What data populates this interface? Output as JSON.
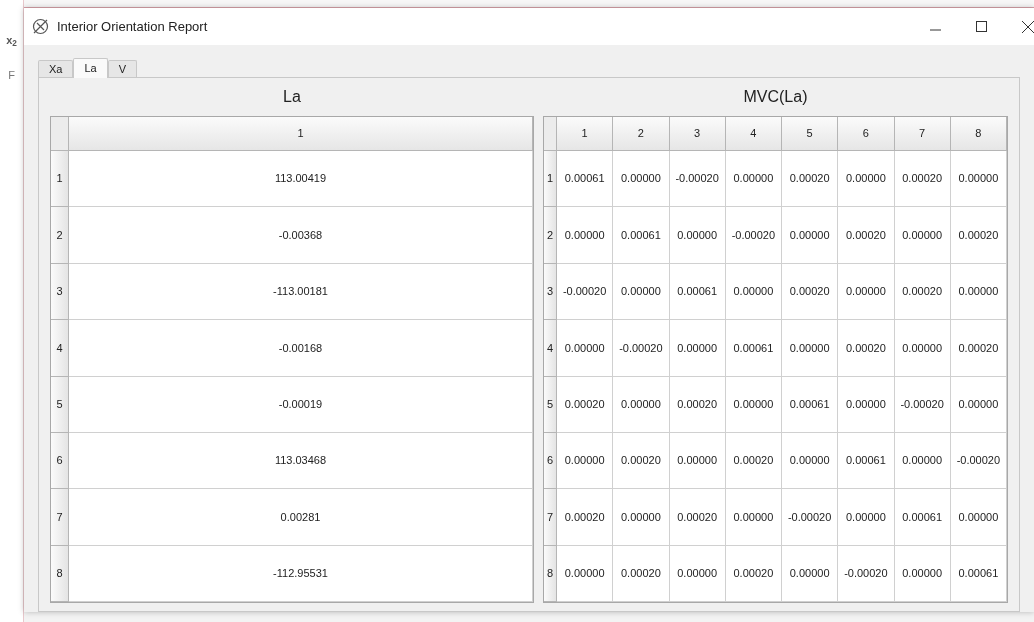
{
  "background": {
    "texts": [
      "x$_{2}$",
      "F"
    ]
  },
  "window": {
    "title": "Interior Orientation Report"
  },
  "tabs": [
    {
      "label": "Xa",
      "selected": false
    },
    {
      "label": "La",
      "selected": true
    },
    {
      "label": "V",
      "selected": false
    }
  ],
  "la_table": {
    "title": "La",
    "columns": [
      "1"
    ],
    "rows": [
      {
        "header": "1",
        "cells": [
          "113.00419"
        ]
      },
      {
        "header": "2",
        "cells": [
          "-0.00368"
        ]
      },
      {
        "header": "3",
        "cells": [
          "-113.00181"
        ]
      },
      {
        "header": "4",
        "cells": [
          "-0.00168"
        ]
      },
      {
        "header": "5",
        "cells": [
          "-0.00019"
        ]
      },
      {
        "header": "6",
        "cells": [
          "113.03468"
        ]
      },
      {
        "header": "7",
        "cells": [
          "0.00281"
        ]
      },
      {
        "header": "8",
        "cells": [
          "-112.95531"
        ]
      }
    ]
  },
  "mvc_table": {
    "title": "MVC(La)",
    "columns": [
      "1",
      "2",
      "3",
      "4",
      "5",
      "6",
      "7",
      "8"
    ],
    "rows": [
      {
        "header": "1",
        "cells": [
          "0.00061",
          "0.00000",
          "-0.00020",
          "0.00000",
          "0.00020",
          "0.00000",
          "0.00020",
          "0.00000"
        ]
      },
      {
        "header": "2",
        "cells": [
          "0.00000",
          "0.00061",
          "0.00000",
          "-0.00020",
          "0.00000",
          "0.00020",
          "0.00000",
          "0.00020"
        ]
      },
      {
        "header": "3",
        "cells": [
          "-0.00020",
          "0.00000",
          "0.00061",
          "0.00000",
          "0.00020",
          "0.00000",
          "0.00020",
          "0.00000"
        ]
      },
      {
        "header": "4",
        "cells": [
          "0.00000",
          "-0.00020",
          "0.00000",
          "0.00061",
          "0.00000",
          "0.00020",
          "0.00000",
          "0.00020"
        ]
      },
      {
        "header": "5",
        "cells": [
          "0.00020",
          "0.00000",
          "0.00020",
          "0.00000",
          "0.00061",
          "0.00000",
          "-0.00020",
          "0.00000"
        ]
      },
      {
        "header": "6",
        "cells": [
          "0.00000",
          "0.00020",
          "0.00000",
          "0.00020",
          "0.00000",
          "0.00061",
          "0.00000",
          "-0.00020"
        ]
      },
      {
        "header": "7",
        "cells": [
          "0.00020",
          "0.00000",
          "0.00020",
          "0.00000",
          "-0.00020",
          "0.00000",
          "0.00061",
          "0.00000"
        ]
      },
      {
        "header": "8",
        "cells": [
          "0.00000",
          "0.00020",
          "0.00000",
          "0.00020",
          "0.00000",
          "-0.00020",
          "0.00000",
          "0.00061"
        ]
      }
    ]
  }
}
